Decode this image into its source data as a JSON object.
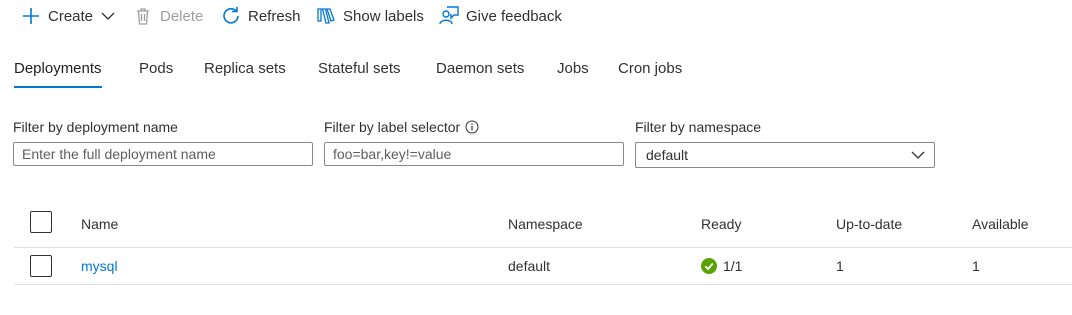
{
  "toolbar": {
    "create_label": "Create",
    "delete_label": "Delete",
    "refresh_label": "Refresh",
    "show_labels_label": "Show labels",
    "feedback_label": "Give feedback"
  },
  "tabs": [
    {
      "label": "Deployments",
      "active": true
    },
    {
      "label": "Pods",
      "active": false
    },
    {
      "label": "Replica sets",
      "active": false
    },
    {
      "label": "Stateful sets",
      "active": false
    },
    {
      "label": "Daemon sets",
      "active": false
    },
    {
      "label": "Jobs",
      "active": false
    },
    {
      "label": "Cron jobs",
      "active": false
    }
  ],
  "filters": {
    "deployment_name": {
      "label": "Filter by deployment name",
      "placeholder": "Enter the full deployment name",
      "value": ""
    },
    "label_selector": {
      "label": "Filter by label selector",
      "placeholder": "foo=bar,key!=value",
      "value": ""
    },
    "namespace": {
      "label": "Filter by namespace",
      "selected": "default"
    }
  },
  "table": {
    "columns": {
      "name": "Name",
      "namespace": "Namespace",
      "ready": "Ready",
      "uptodate": "Up-to-date",
      "available": "Available"
    },
    "rows": [
      {
        "name": "mysql",
        "namespace": "default",
        "ready": "1/1",
        "uptodate": "1",
        "available": "1"
      }
    ]
  },
  "colors": {
    "accent": "#0078d4",
    "success": "#57a300",
    "text": "#323130",
    "disabled": "#a19f9d"
  },
  "icons": {
    "create": "plus-icon",
    "create_dropdown": "chevron-down-icon",
    "delete": "trash-icon",
    "refresh": "refresh-icon",
    "show_labels": "tag-icon",
    "feedback": "feedback-icon",
    "info": "info-icon",
    "namespace_dropdown": "chevron-down-icon",
    "ready": "check-circle-icon"
  }
}
